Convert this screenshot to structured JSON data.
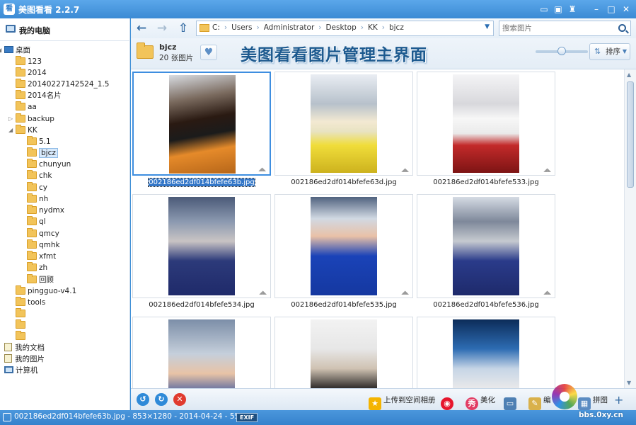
{
  "app": {
    "title": "美图看看 2.2.7",
    "icon_letter": "看"
  },
  "titlebar_buttons": [
    "comment-icon",
    "skin-icon",
    "tshirt-icon",
    "minimize-icon",
    "maximize-icon",
    "close-icon"
  ],
  "sidebar": {
    "my_computer": "我的电脑",
    "tree": [
      {
        "label": "桌面",
        "type": "desktop",
        "level": 0,
        "expanded": true
      },
      {
        "label": "123",
        "type": "folder",
        "level": 1
      },
      {
        "label": "2014",
        "type": "folder",
        "level": 1
      },
      {
        "label": "20140227142524_1.5",
        "type": "folder",
        "level": 1
      },
      {
        "label": "2014名片",
        "type": "folder",
        "level": 1
      },
      {
        "label": "aa",
        "type": "folder",
        "level": 1
      },
      {
        "label": "backup",
        "type": "folder",
        "level": 1,
        "collapsed_arrow": true
      },
      {
        "label": "KK",
        "type": "folder",
        "level": 1,
        "expanded": true
      },
      {
        "label": "5.1",
        "type": "folder",
        "level": 2
      },
      {
        "label": "bjcz",
        "type": "folder",
        "level": 2,
        "selected": true
      },
      {
        "label": "chunyun",
        "type": "folder",
        "level": 2
      },
      {
        "label": "chk",
        "type": "folder",
        "level": 2
      },
      {
        "label": "cy",
        "type": "folder",
        "level": 2
      },
      {
        "label": "nh",
        "type": "folder",
        "level": 2
      },
      {
        "label": "nydmx",
        "type": "folder",
        "level": 2
      },
      {
        "label": "ql",
        "type": "folder",
        "level": 2
      },
      {
        "label": "qmcy",
        "type": "folder",
        "level": 2
      },
      {
        "label": "qmhk",
        "type": "folder",
        "level": 2
      },
      {
        "label": "xfmt",
        "type": "folder",
        "level": 2
      },
      {
        "label": "zh",
        "type": "folder",
        "level": 2
      },
      {
        "label": "回顾",
        "type": "folder",
        "level": 2
      },
      {
        "label": "pingguo-v4.1",
        "type": "folder",
        "level": 1
      },
      {
        "label": "tools",
        "type": "folder",
        "level": 1
      },
      {
        "label": "",
        "type": "folder",
        "level": 1
      },
      {
        "label": "",
        "type": "folder",
        "level": 1
      },
      {
        "label": "",
        "type": "folder",
        "level": 1
      },
      {
        "label": "我的文档",
        "type": "doc",
        "level": 0
      },
      {
        "label": "我的图片",
        "type": "doc",
        "level": 0
      },
      {
        "label": "计算机",
        "type": "pc",
        "level": 0
      }
    ]
  },
  "nav": {
    "breadcrumbs": [
      "C:",
      "Users",
      "Administrator",
      "Desktop",
      "KK",
      "bjcz"
    ],
    "search_placeholder": "搜索图片"
  },
  "folder_info": {
    "name": "bjcz",
    "count": "20 张图片",
    "banner": "美图看看图片管理主界面",
    "sort_label": "排序",
    "zoom_level": 0.45
  },
  "thumbnails": [
    {
      "filename": "002186ed2df014bfefe63b.jpg",
      "selected": true,
      "style": "p1"
    },
    {
      "filename": "002186ed2df014bfefe63d.jpg",
      "style": "p2"
    },
    {
      "filename": "002186ed2df014bfefe533.jpg",
      "style": "p3"
    },
    {
      "filename": "002186ed2df014bfefe534.jpg",
      "style": "p4"
    },
    {
      "filename": "002186ed2df014bfefe535.jpg",
      "style": "p5"
    },
    {
      "filename": "002186ed2df014bfefe536.jpg",
      "style": "p6"
    },
    {
      "filename": "",
      "style": "p7"
    },
    {
      "filename": "",
      "style": "p8"
    },
    {
      "filename": "",
      "style": "p9"
    }
  ],
  "bottombar": {
    "upload_label": "上传到空间相册",
    "beautify_label": "美化",
    "edit_label": "编",
    "puzzle_label": "拼图"
  },
  "status": {
    "text": "002186ed2df014bfefe63b.jpg - 853×1280 - 2014-04-24 - 554KB",
    "exif": "EXIF"
  },
  "watermark": {
    "text": "bbs.0xy.cn"
  }
}
